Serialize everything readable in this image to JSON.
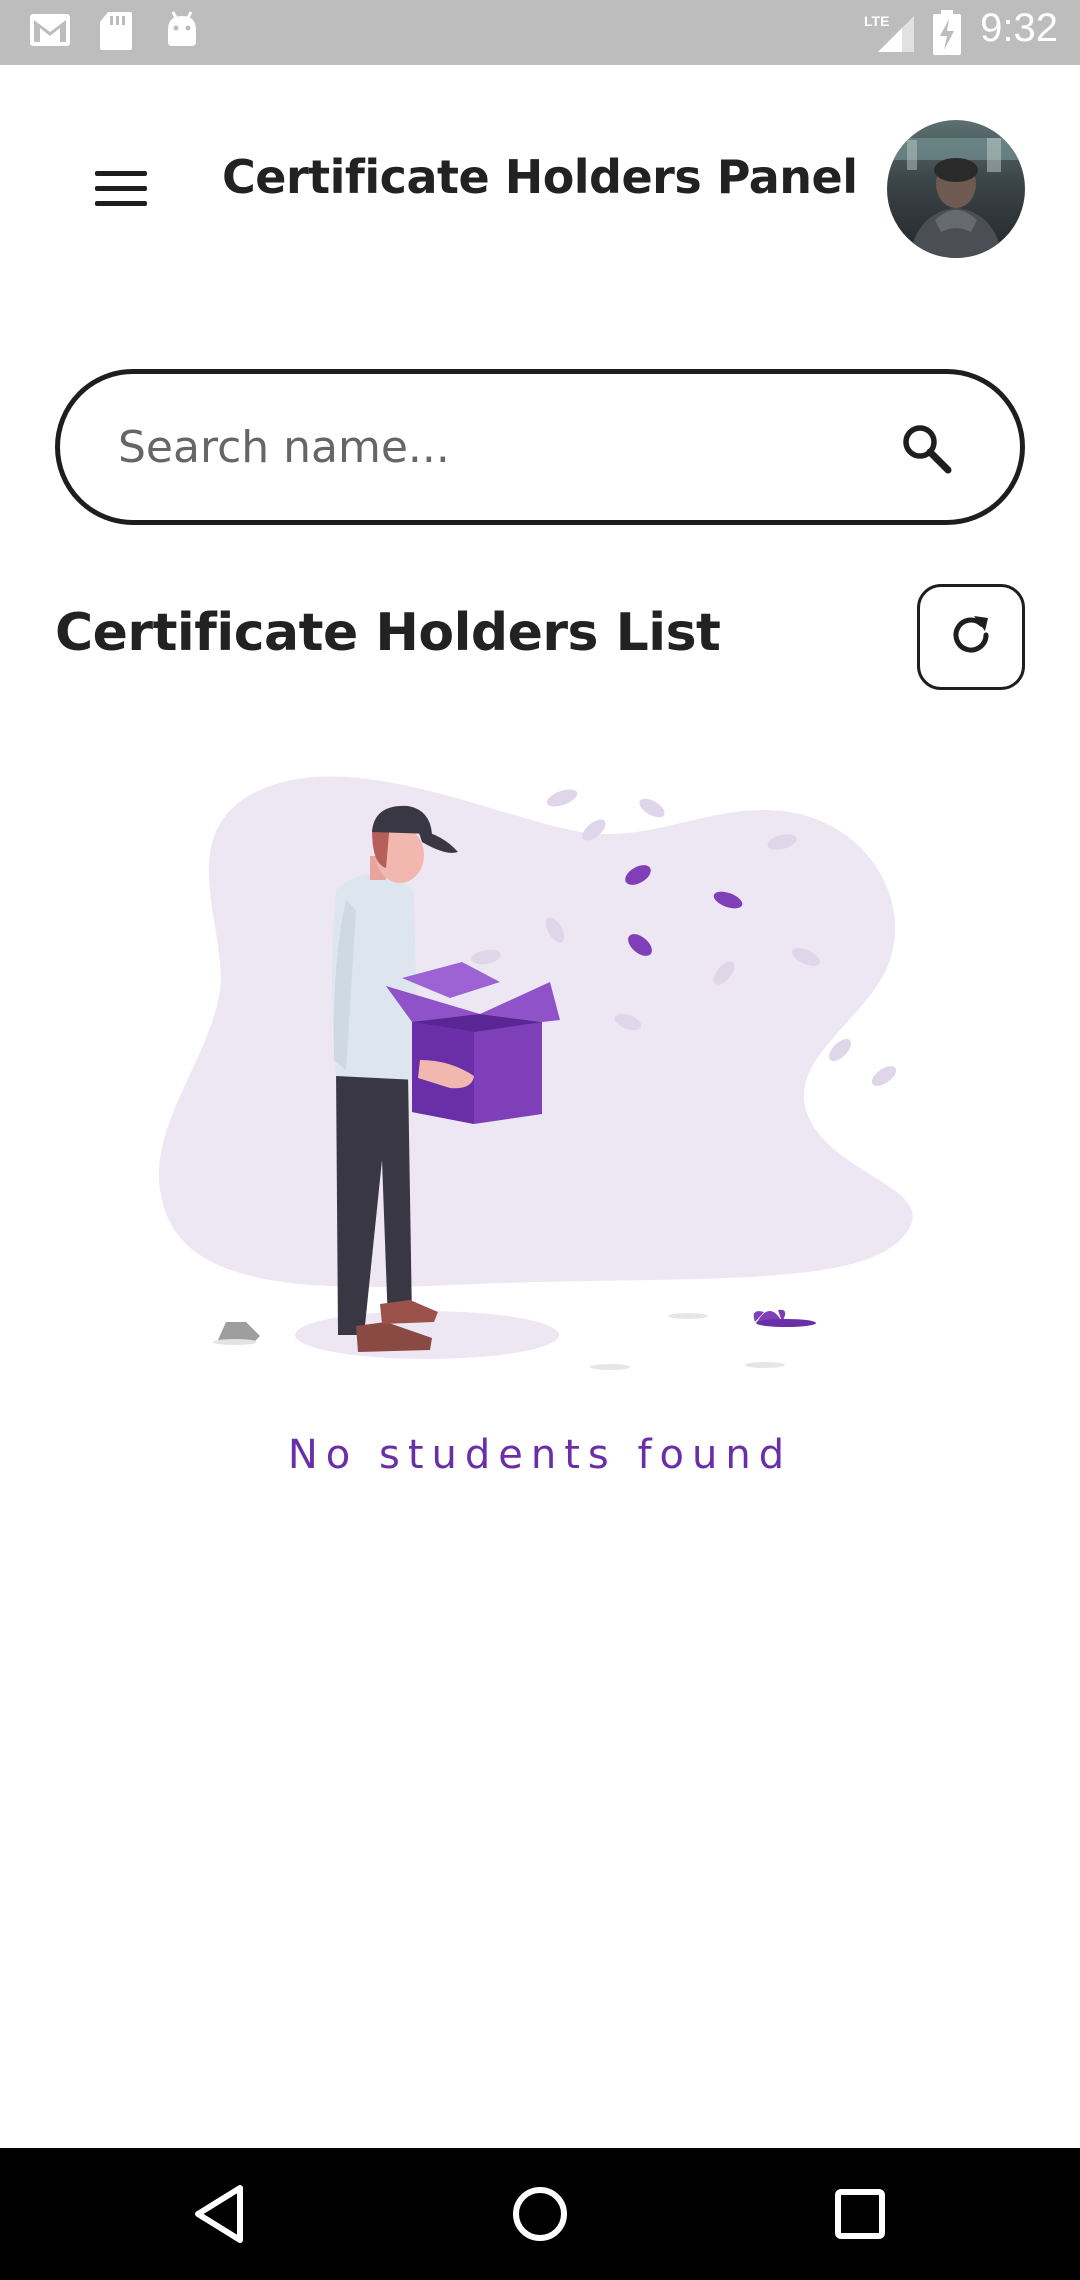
{
  "status_bar": {
    "time": "9:32",
    "network": "LTE",
    "icons": [
      "gmail-icon",
      "sd-card-icon",
      "android-icon",
      "lte-signal-icon",
      "battery-charging-icon"
    ]
  },
  "header": {
    "title": "Certificate Holders Panel",
    "menu_icon": "hamburger-menu-icon"
  },
  "search": {
    "placeholder": "Search name...",
    "value": "",
    "icon": "search-icon"
  },
  "list": {
    "title": "Certificate Holders List",
    "refresh_icon": "refresh-icon",
    "empty_message": "No students found"
  },
  "colors": {
    "accent": "#6a2fa8",
    "illustration_bg": "#ede7f3",
    "box_purple": "#7e3fb8"
  },
  "nav_bar": {
    "icons": [
      "back-icon",
      "home-icon",
      "recents-icon"
    ]
  }
}
